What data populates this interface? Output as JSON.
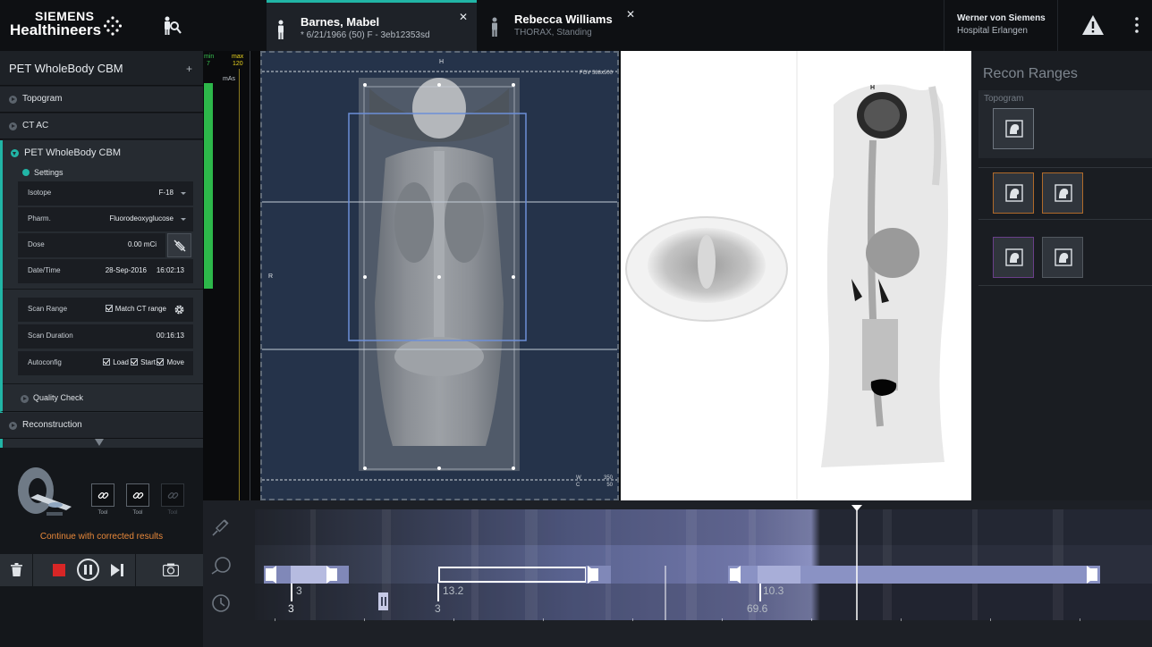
{
  "header": {
    "logo_line1": "SIEMENS",
    "logo_line2": "Healthineers",
    "tabs": [
      {
        "name": "Barnes, Mabel",
        "sub": "* 6/21/1966 (50)    F - 3eb12353sd",
        "active": true
      },
      {
        "name": "Rebecca Williams",
        "sub": "THORAX, Standing",
        "active": false
      }
    ],
    "close_glyph": "✕",
    "user_name": "Werner von Siemens",
    "user_hospital": "Hospital Erlangen"
  },
  "left_panel": {
    "title": "PET WholeBody CBM",
    "add_glyph": "+",
    "sections": {
      "topogram": "Topogram",
      "ctac": "CT AC",
      "pet": "PET WholeBody CBM",
      "settings": "Settings",
      "quality": "Quality Check",
      "recon": "Reconstruction"
    },
    "fields": {
      "isotope_label": "Isotope",
      "isotope_value": "F-18",
      "pharm_label": "Pharm.",
      "pharm_value": "Fluorodeoxyglucose",
      "dose_label": "Dose",
      "dose_value": "0.00 mCi",
      "datetime_label": "Date/Time",
      "date_value": "28-Sep-2016",
      "time_value": "16:02:13",
      "scanrange_label": "Scan Range",
      "match_ct": "Match CT range",
      "duration_label": "Scan Duration",
      "duration_value": "00:16:13",
      "autoconfig_label": "Autoconfig",
      "load": "Load",
      "start": "Start",
      "move": "Move"
    },
    "tools": [
      "Tool",
      "Tool",
      "Tool"
    ],
    "continue_text": "Continue with corrected results"
  },
  "strip": {
    "min_label": "min",
    "min_value": "7",
    "max_label": "max",
    "max_value": "120",
    "unit": "mAs"
  },
  "topogram_view": {
    "orientation_top": "H",
    "orientation_left": "R",
    "fov": "FOV 588x500",
    "w_label": "W",
    "c_label": "C",
    "w_value": "350",
    "c_value": "50"
  },
  "pet_view": {
    "orientation_top": "H"
  },
  "recon_panel": {
    "title": "Recon Ranges",
    "topogram_label": "Topogram"
  },
  "timeline": {
    "markers": [
      {
        "top": "3",
        "bottom": "3"
      },
      {
        "top": "13.2",
        "bottom": "3"
      },
      {
        "top": "10.3",
        "bottom": "69.6"
      }
    ]
  },
  "colors": {
    "accent": "#21b5a6",
    "warning": "#e8883a",
    "stop": "#d82626"
  }
}
